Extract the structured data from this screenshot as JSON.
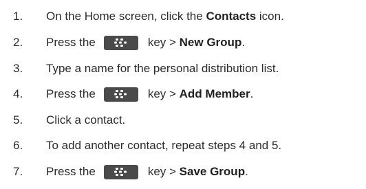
{
  "steps": [
    {
      "number": "1.",
      "parts": [
        {
          "type": "text",
          "value": "On the Home screen, click the "
        },
        {
          "type": "bold",
          "value": "Contacts"
        },
        {
          "type": "text",
          "value": " icon."
        }
      ]
    },
    {
      "number": "2.",
      "parts": [
        {
          "type": "text",
          "value": "Press the"
        },
        {
          "type": "key",
          "icon": "blackberry-menu-key-icon"
        },
        {
          "type": "text",
          "value": "key > "
        },
        {
          "type": "bold",
          "value": "New Group"
        },
        {
          "type": "text",
          "value": "."
        }
      ]
    },
    {
      "number": "3.",
      "parts": [
        {
          "type": "text",
          "value": "Type a name for the personal distribution list."
        }
      ]
    },
    {
      "number": "4.",
      "parts": [
        {
          "type": "text",
          "value": "Press the"
        },
        {
          "type": "key",
          "icon": "blackberry-menu-key-icon"
        },
        {
          "type": "text",
          "value": "key > "
        },
        {
          "type": "bold",
          "value": "Add Member"
        },
        {
          "type": "text",
          "value": "."
        }
      ]
    },
    {
      "number": "5.",
      "parts": [
        {
          "type": "text",
          "value": "Click a contact."
        }
      ]
    },
    {
      "number": "6.",
      "parts": [
        {
          "type": "text",
          "value": "To add another contact, repeat steps 4 and 5."
        }
      ]
    },
    {
      "number": "7.",
      "parts": [
        {
          "type": "text",
          "value": "Press the"
        },
        {
          "type": "key",
          "icon": "blackberry-menu-key-icon"
        },
        {
          "type": "text",
          "value": "key > "
        },
        {
          "type": "bold",
          "value": "Save Group"
        },
        {
          "type": "text",
          "value": "."
        }
      ]
    }
  ],
  "colors": {
    "text": "#2b2b2b",
    "key_background": "#4a4a4a",
    "key_glyph": "#ffffff"
  }
}
